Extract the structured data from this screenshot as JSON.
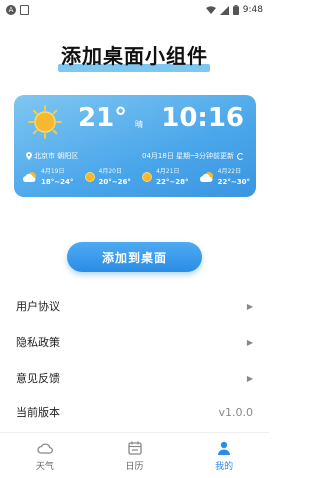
{
  "status_bar": {
    "time": "9:48",
    "left_badge": "A"
  },
  "title": "添加桌面小组件",
  "widget": {
    "temperature": "21°",
    "condition": "晴",
    "time": "10:16",
    "location": "北京市 朝阳区",
    "date": "04月18日 星期一",
    "updated": "3分钟前更新",
    "forecast": [
      {
        "date": "4月19日",
        "range": "18°~24°",
        "icon": "cloud-sun-icon"
      },
      {
        "date": "4月20日",
        "range": "20°~26°",
        "icon": "sun-icon"
      },
      {
        "date": "4月21日",
        "range": "22°~28°",
        "icon": "sun-icon"
      },
      {
        "date": "4月22日",
        "range": "22°~30°",
        "icon": "cloud-sun-icon"
      }
    ]
  },
  "add_button": "添加到桌面",
  "menu": [
    {
      "label": "用户协议"
    },
    {
      "label": "隐私政策"
    },
    {
      "label": "意见反馈"
    },
    {
      "label": "当前版本",
      "value": "v1.0.0"
    }
  ],
  "bottom_nav": [
    {
      "label": "天气",
      "icon": "cloud-icon"
    },
    {
      "label": "日历",
      "icon": "calendar-icon"
    },
    {
      "label": "我的",
      "icon": "user-icon",
      "active": true
    }
  ],
  "colors": {
    "accent": "#2b8de6",
    "card_top": "#7fc6f2",
    "card_bottom": "#3b95e2",
    "sun": "#f5b82e"
  }
}
